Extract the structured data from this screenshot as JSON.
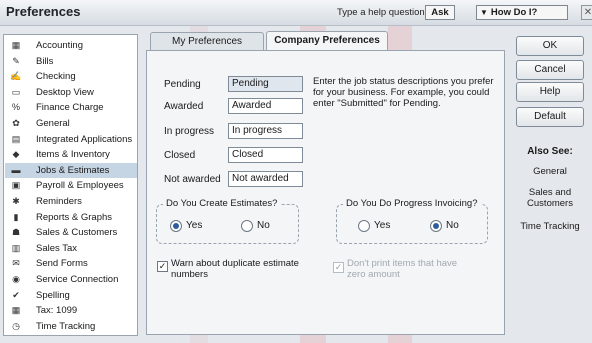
{
  "window": {
    "title": "Preferences",
    "help_question": "Type a help question",
    "ask_label": "Ask",
    "how_do_i_label": "How Do I?",
    "close_glyph": "✕"
  },
  "categories": [
    {
      "label": "Accounting",
      "icon": "accounting-icon",
      "glyph": "▦"
    },
    {
      "label": "Bills",
      "icon": "bills-icon",
      "glyph": "✎"
    },
    {
      "label": "Checking",
      "icon": "checking-icon",
      "glyph": "✍"
    },
    {
      "label": "Desktop View",
      "icon": "desktop-view-icon",
      "glyph": "▭"
    },
    {
      "label": "Finance Charge",
      "icon": "finance-charge-icon",
      "glyph": "%"
    },
    {
      "label": "General",
      "icon": "general-icon",
      "glyph": "✿"
    },
    {
      "label": "Integrated Applications",
      "icon": "integrated-applications-icon",
      "glyph": "▤"
    },
    {
      "label": "Items & Inventory",
      "icon": "items-inventory-icon",
      "glyph": "◆"
    },
    {
      "label": "Jobs & Estimates",
      "icon": "jobs-estimates-icon",
      "glyph": "▬",
      "selected": true
    },
    {
      "label": "Payroll & Employees",
      "icon": "payroll-employees-icon",
      "glyph": "▣"
    },
    {
      "label": "Reminders",
      "icon": "reminders-icon",
      "glyph": "✱"
    },
    {
      "label": "Reports & Graphs",
      "icon": "reports-graphs-icon",
      "glyph": "▮"
    },
    {
      "label": "Sales & Customers",
      "icon": "sales-customers-icon",
      "glyph": "☗"
    },
    {
      "label": "Sales Tax",
      "icon": "sales-tax-icon",
      "glyph": "▥"
    },
    {
      "label": "Send Forms",
      "icon": "send-forms-icon",
      "glyph": "✉"
    },
    {
      "label": "Service Connection",
      "icon": "service-connection-icon",
      "glyph": "◉"
    },
    {
      "label": "Spelling",
      "icon": "spelling-icon",
      "glyph": "✔"
    },
    {
      "label": "Tax: 1099",
      "icon": "tax-1099-icon",
      "glyph": "▦"
    },
    {
      "label": "Time Tracking",
      "icon": "time-tracking-icon",
      "glyph": "◷"
    }
  ],
  "tabs": {
    "my": "My Preferences",
    "company": "Company Preferences"
  },
  "status_rows": [
    {
      "label": "Pending",
      "value": "Pending"
    },
    {
      "label": "Awarded",
      "value": "Awarded"
    },
    {
      "label": "In progress",
      "value": "In progress"
    },
    {
      "label": "Closed",
      "value": "Closed"
    },
    {
      "label": "Not awarded",
      "value": "Not awarded"
    }
  ],
  "help_text": "Enter the job status descriptions you prefer for your business.  For example, you could enter \"Submitted\" for Pending.",
  "estimates_group": {
    "title": "Do You Create Estimates?",
    "yes": "Yes",
    "no": "No",
    "selected": "yes"
  },
  "progress_group": {
    "title": "Do You Do Progress Invoicing?",
    "yes": "Yes",
    "no": "No",
    "selected": "no"
  },
  "checkboxes": {
    "warn_duplicate": {
      "label": "Warn about duplicate estimate numbers",
      "checked": true,
      "enabled": true
    },
    "dont_print_zero": {
      "label": "Don't print items that have zero amount",
      "checked": true,
      "enabled": false
    }
  },
  "buttons": {
    "ok": "OK",
    "cancel": "Cancel",
    "help": "Help",
    "default": "Default"
  },
  "also_see": {
    "title": "Also See:",
    "links": [
      "General",
      "Sales and Customers",
      "Time Tracking"
    ]
  },
  "colors": {
    "selected_row": "#c6d5e4",
    "panel_bg": "#f3f5f7",
    "frame_bg": "#e4e8ec"
  }
}
